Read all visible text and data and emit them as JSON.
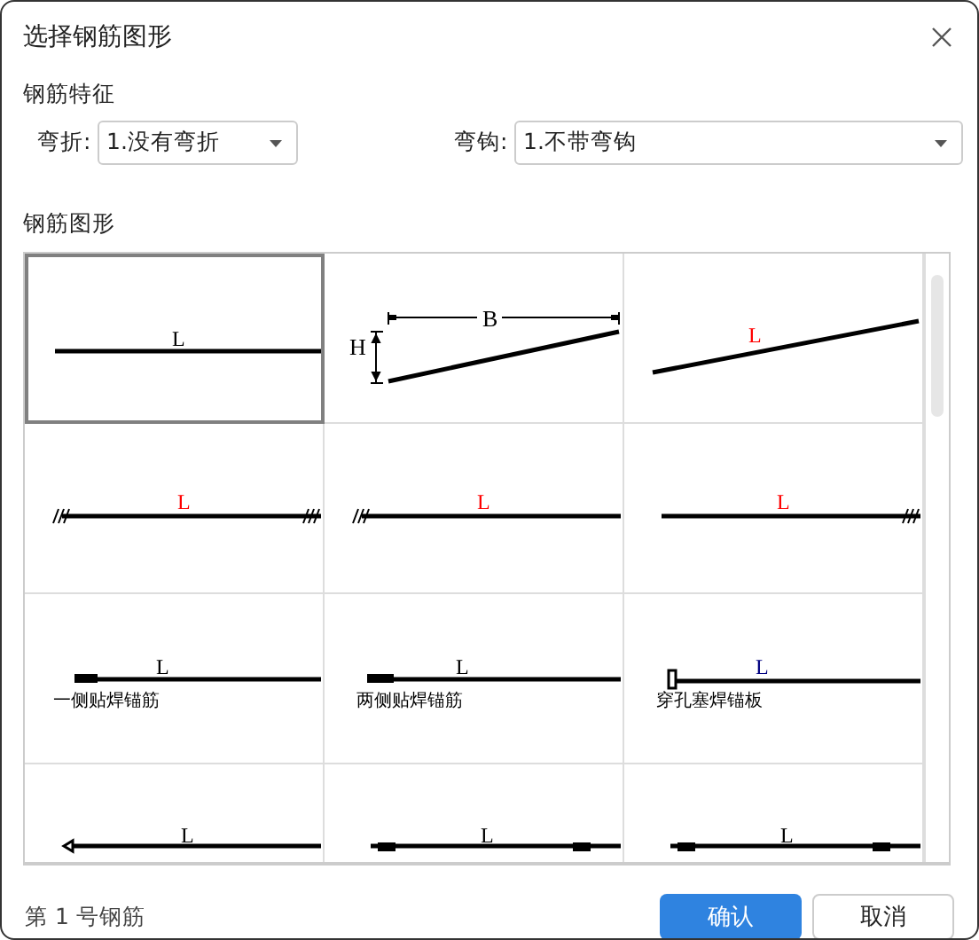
{
  "dialog": {
    "title": "选择钢筋图形"
  },
  "features": {
    "heading": "钢筋特征",
    "bend": {
      "label": "弯折:",
      "value": "1.没有弯折"
    },
    "hook": {
      "label": "弯钩:",
      "value": "1.不带弯钩"
    }
  },
  "shapes": {
    "heading": "钢筋图形",
    "cells": [
      {
        "kind": "straight",
        "label": "L",
        "color": "#000000",
        "selected": true
      },
      {
        "kind": "slope-dimension",
        "labels": [
          "H",
          "B"
        ],
        "selected": false
      },
      {
        "kind": "slope",
        "label": "L",
        "color": "#ff0000",
        "selected": false
      },
      {
        "kind": "both-anchor",
        "label": "L",
        "color": "#ff0000",
        "selected": false
      },
      {
        "kind": "left-anchor",
        "label": "L",
        "color": "#ff0000",
        "selected": false
      },
      {
        "kind": "right-anchor",
        "label": "L",
        "color": "#ff0000",
        "selected": false
      },
      {
        "kind": "one-side-weld",
        "label": "L",
        "color": "#000000",
        "caption": "一侧贴焊锚筋",
        "selected": false
      },
      {
        "kind": "two-side-weld",
        "label": "L",
        "color": "#000000",
        "caption": "两侧贴焊锚筋",
        "selected": false
      },
      {
        "kind": "plug-weld",
        "label": "L",
        "color": "#000080",
        "caption": "穿孔塞焊锚板",
        "selected": false
      },
      {
        "kind": "end-plate",
        "label": "L",
        "color": "#000000",
        "selected": false
      },
      {
        "kind": "right-weld",
        "label": "L",
        "color": "#000000",
        "selected": false
      },
      {
        "kind": "both-weld",
        "label": "L",
        "color": "#000000",
        "selected": false
      }
    ]
  },
  "status": "第 1 号钢筋",
  "buttons": {
    "confirm": "确认",
    "cancel": "取消"
  }
}
